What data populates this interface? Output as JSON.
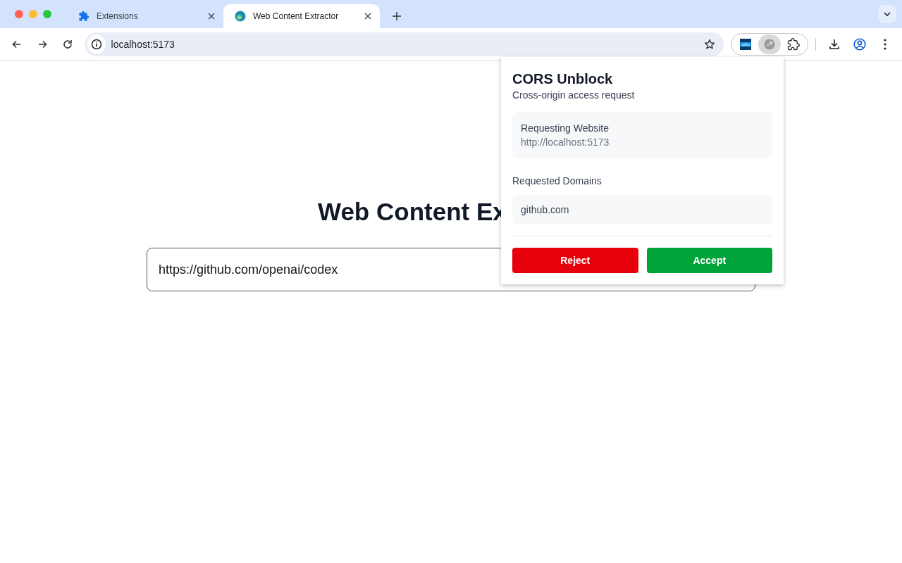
{
  "browser": {
    "tabs": [
      {
        "title": "Extensions",
        "kind": "puzzle",
        "selected": false
      },
      {
        "title": "Web Content Extractor",
        "kind": "globe",
        "selected": true
      }
    ],
    "address": "localhost:5173",
    "extensions": [
      {
        "kind": "picture",
        "active": false
      },
      {
        "kind": "globe",
        "active": true
      },
      {
        "kind": "puzzle",
        "active": false
      }
    ]
  },
  "page": {
    "heading": "Web Content Ex",
    "url_input": {
      "value": "https://github.com/openai/codex"
    }
  },
  "popup": {
    "title": "CORS Unblock",
    "subtitle": "Cross-origin access request",
    "requesting": {
      "label": "Requesting Website",
      "value": "http://localhost:5173"
    },
    "domains_label": "Requested Domains",
    "domains": [
      "github.com"
    ],
    "buttons": [
      {
        "label": "Reject",
        "kind": "reject"
      },
      {
        "label": "Accept",
        "kind": "accept"
      }
    ]
  }
}
